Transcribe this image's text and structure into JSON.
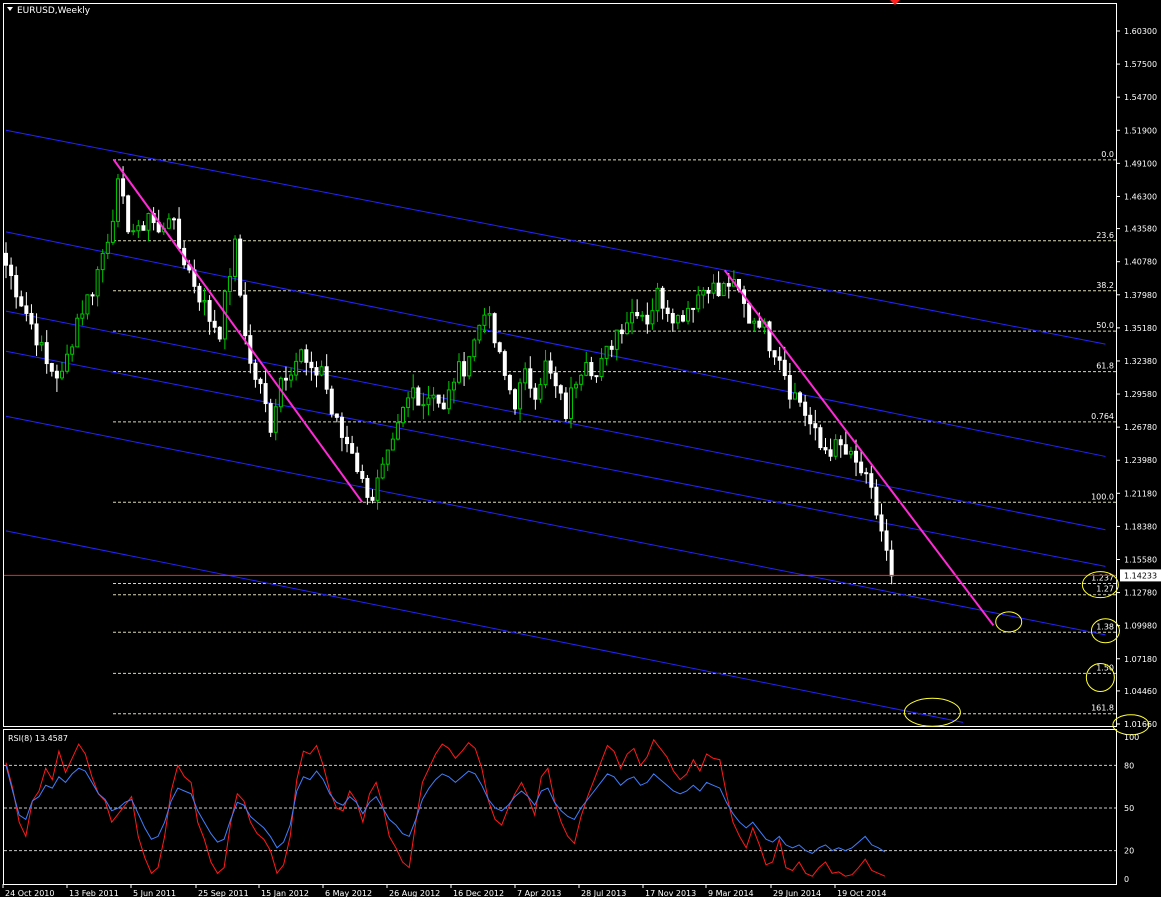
{
  "window_title": "EURUSD,Weekly",
  "colors": {
    "background": "#000000",
    "bull_candle": "#00c800",
    "bear_candle": "#ffffff",
    "trendline": "#ff2bd6",
    "channel": "#2323ff",
    "fib": "#d8d8b0",
    "price_line": "#ff2020",
    "ellipse": "#ffff33",
    "rsi_red": "#ff1a1a",
    "rsi_blue": "#3f7fff"
  },
  "chart_data": [
    {
      "type": "candlestick",
      "symbol": "EURUSD",
      "timeframe": "Weekly",
      "current_price": "1.14233",
      "y_ticks": [
        "1.60300",
        "1.57500",
        "1.54700",
        "1.51900",
        "1.49100",
        "1.46300",
        "1.43580",
        "1.40780",
        "1.37980",
        "1.35180",
        "1.32380",
        "1.29580",
        "1.26780",
        "1.23980",
        "1.21180",
        "1.18380",
        "1.15580",
        "1.12780",
        "1.09980",
        "1.07180",
        "1.04460",
        "1.01660"
      ],
      "x_ticks": [
        "24 Oct 2010",
        "13 Feb 2011",
        "5 Jun 2011",
        "25 Sep 2011",
        "15 Jan 2012",
        "6 May 2012",
        "26 Aug 2012",
        "16 Dec 2012",
        "7 Apr 2013",
        "28 Jul 2013",
        "17 Nov 2013",
        "9 Mar 2014",
        "29 Jun 2014",
        "19 Oct 2014"
      ],
      "ylim": [
        1.0046,
        1.624
      ],
      "close_path": [
        [
          0,
          1.405
        ],
        [
          6,
          1.345
        ],
        [
          8,
          1.32
        ],
        [
          11,
          1.31
        ],
        [
          14,
          1.36
        ],
        [
          17,
          1.385
        ],
        [
          20,
          1.43
        ],
        [
          22,
          1.47
        ],
        [
          24,
          1.44
        ],
        [
          26,
          1.43
        ],
        [
          28,
          1.45
        ],
        [
          30,
          1.43
        ],
        [
          32,
          1.45
        ],
        [
          34,
          1.42
        ],
        [
          36,
          1.4
        ],
        [
          38,
          1.38
        ],
        [
          40,
          1.36
        ],
        [
          42,
          1.35
        ],
        [
          44,
          1.4
        ],
        [
          45,
          1.42
        ],
        [
          46,
          1.38
        ],
        [
          48,
          1.32
        ],
        [
          50,
          1.3
        ],
        [
          52,
          1.27
        ],
        [
          54,
          1.31
        ],
        [
          56,
          1.32
        ],
        [
          58,
          1.33
        ],
        [
          60,
          1.31
        ],
        [
          62,
          1.32
        ],
        [
          64,
          1.28
        ],
        [
          66,
          1.26
        ],
        [
          68,
          1.25
        ],
        [
          70,
          1.22
        ],
        [
          72,
          1.21
        ],
        [
          74,
          1.23
        ],
        [
          76,
          1.25
        ],
        [
          78,
          1.28
        ],
        [
          80,
          1.3
        ],
        [
          82,
          1.29
        ],
        [
          84,
          1.3
        ],
        [
          86,
          1.28
        ],
        [
          88,
          1.31
        ],
        [
          90,
          1.32
        ],
        [
          92,
          1.34
        ],
        [
          94,
          1.37
        ],
        [
          96,
          1.34
        ],
        [
          98,
          1.31
        ],
        [
          100,
          1.29
        ],
        [
          102,
          1.31
        ],
        [
          104,
          1.3
        ],
        [
          106,
          1.32
        ],
        [
          108,
          1.3
        ],
        [
          110,
          1.28
        ],
        [
          112,
          1.31
        ],
        [
          114,
          1.33
        ],
        [
          116,
          1.31
        ],
        [
          118,
          1.33
        ],
        [
          120,
          1.35
        ],
        [
          122,
          1.36
        ],
        [
          124,
          1.37
        ],
        [
          126,
          1.36
        ],
        [
          128,
          1.38
        ],
        [
          130,
          1.37
        ],
        [
          132,
          1.36
        ],
        [
          134,
          1.37
        ],
        [
          136,
          1.38
        ],
        [
          138,
          1.39
        ],
        [
          140,
          1.38
        ],
        [
          142,
          1.39
        ],
        [
          144,
          1.38
        ],
        [
          146,
          1.36
        ],
        [
          148,
          1.36
        ],
        [
          150,
          1.34
        ],
        [
          152,
          1.33
        ],
        [
          154,
          1.3
        ],
        [
          156,
          1.29
        ],
        [
          158,
          1.27
        ],
        [
          160,
          1.25
        ],
        [
          162,
          1.25
        ],
        [
          164,
          1.25
        ],
        [
          166,
          1.24
        ],
        [
          168,
          1.23
        ],
        [
          170,
          1.21
        ],
        [
          172,
          1.18
        ],
        [
          173,
          1.16
        ],
        [
          174,
          1.142
        ]
      ],
      "fibonacci": {
        "range": [
          1.4939,
          1.2042
        ],
        "levels": [
          {
            "label": "0.0",
            "value": 1.4939
          },
          {
            "label": "23.6",
            "value": 1.4255
          },
          {
            "label": "38.2",
            "value": 1.3832
          },
          {
            "label": "50.0",
            "value": 1.349
          },
          {
            "label": "61.8",
            "value": 1.3148
          },
          {
            "label": "0.764",
            "value": 1.2723
          },
          {
            "label": "100.0",
            "value": 1.2042
          },
          {
            "label": "1.237",
            "value": 1.1355
          },
          {
            "label": "1.27",
            "value": 1.126
          },
          {
            "label": "1.38",
            "value": 1.0942
          },
          {
            "label": "1.50",
            "value": 1.0594
          },
          {
            "label": "161.8",
            "value": 1.0253
          }
        ]
      },
      "trendlines": [
        {
          "from": [
            21,
            1.4939
          ],
          "to": [
            70,
            1.2042
          ]
        },
        {
          "from": [
            141,
            1.4005
          ],
          "to": [
            194,
            1.1
          ]
        }
      ],
      "channel_lines": [
        {
          "from": [
            0,
            1.519
          ],
          "to": [
            216,
            1.338
          ]
        },
        {
          "from": [
            0,
            1.433
          ],
          "to": [
            216,
            1.243
          ]
        },
        {
          "from": [
            0,
            1.366
          ],
          "to": [
            216,
            1.181
          ]
        },
        {
          "from": [
            0,
            1.332
          ],
          "to": [
            216,
            1.15
          ]
        },
        {
          "from": [
            0,
            1.277
          ],
          "to": [
            216,
            1.092
          ]
        },
        {
          "from": [
            0,
            1.18
          ],
          "to": [
            188,
            1.018
          ]
        }
      ],
      "ellipses": [
        {
          "x": 215,
          "y": 1.1345
        },
        {
          "x": 197,
          "y": 1.103
        },
        {
          "x": 216,
          "y": 1.0955
        },
        {
          "x": 215,
          "y": 1.056
        },
        {
          "x": 182,
          "y": 1.0265
        },
        {
          "x": 221,
          "y": 1.016
        }
      ]
    },
    {
      "type": "line",
      "title": "RSI(8) 13.4587",
      "ylim": [
        0,
        100
      ],
      "levels": [
        "100",
        "80",
        "50",
        "20",
        "0"
      ],
      "series": [
        {
          "color": "red",
          "values": [
            82,
            64,
            40,
            30,
            55,
            62,
            78,
            70,
            90,
            75,
            85,
            95,
            88,
            72,
            60,
            55,
            40,
            46,
            52,
            58,
            30,
            15,
            4,
            8,
            30,
            62,
            80,
            72,
            68,
            40,
            28,
            12,
            4,
            8,
            40,
            60,
            55,
            40,
            32,
            28,
            20,
            4,
            10,
            30,
            70,
            90,
            88,
            94,
            80,
            62,
            50,
            48,
            62,
            55,
            40,
            60,
            68,
            52,
            30,
            22,
            12,
            8,
            40,
            68,
            78,
            88,
            95,
            92,
            85,
            90,
            96,
            92,
            78,
            55,
            42,
            38,
            50,
            60,
            68,
            58,
            45,
            72,
            78,
            55,
            40,
            30,
            25,
            44,
            58,
            70,
            82,
            94,
            90,
            78,
            88,
            92,
            80,
            86,
            98,
            92,
            86,
            76,
            70,
            74,
            84,
            76,
            88,
            85,
            84,
            60,
            40,
            30,
            22,
            36,
            24,
            10,
            12,
            28,
            8,
            6,
            12,
            4,
            2,
            8,
            12,
            4,
            5,
            2,
            3,
            8,
            14,
            6,
            4,
            2
          ]
        },
        {
          "color": "blue",
          "values": [
            80,
            62,
            45,
            42,
            55,
            58,
            66,
            64,
            72,
            68,
            74,
            78,
            76,
            68,
            60,
            56,
            48,
            50,
            54,
            56,
            46,
            36,
            28,
            30,
            40,
            55,
            64,
            62,
            60,
            48,
            40,
            32,
            26,
            28,
            42,
            54,
            52,
            44,
            40,
            36,
            30,
            22,
            26,
            38,
            62,
            72,
            70,
            76,
            70,
            60,
            54,
            52,
            58,
            54,
            46,
            54,
            58,
            50,
            42,
            38,
            32,
            30,
            42,
            56,
            64,
            70,
            74,
            72,
            68,
            72,
            76,
            74,
            66,
            56,
            50,
            48,
            52,
            58,
            62,
            58,
            52,
            62,
            64,
            54,
            48,
            44,
            42,
            50,
            56,
            62,
            68,
            74,
            72,
            66,
            70,
            72,
            66,
            68,
            74,
            70,
            66,
            62,
            60,
            62,
            66,
            62,
            68,
            66,
            64,
            54,
            46,
            40,
            36,
            40,
            34,
            28,
            26,
            30,
            24,
            22,
            24,
            20,
            18,
            22,
            24,
            20,
            22,
            20,
            22,
            26,
            30,
            24,
            22,
            19
          ]
        }
      ]
    }
  ]
}
